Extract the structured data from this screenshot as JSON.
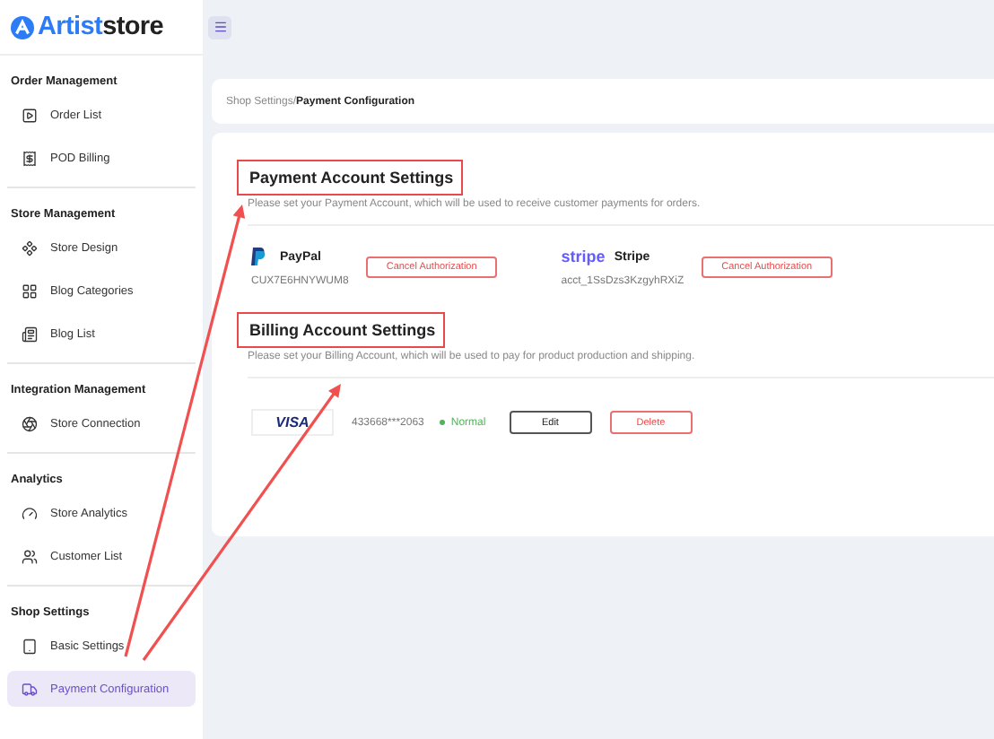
{
  "logo": {
    "brand": "Artist",
    "suffix": "store"
  },
  "sidebar": {
    "groups": [
      {
        "title": "Order Management",
        "items": [
          {
            "label": "Order List",
            "selected": false
          },
          {
            "label": "POD Billing",
            "selected": false
          }
        ]
      },
      {
        "title": "Store Management",
        "items": [
          {
            "label": "Store Design",
            "selected": false
          },
          {
            "label": "Blog Categories",
            "selected": false
          },
          {
            "label": "Blog List",
            "selected": false
          }
        ]
      },
      {
        "title": "Integration Management",
        "items": [
          {
            "label": "Store Connection",
            "selected": false
          }
        ]
      },
      {
        "title": "Analytics",
        "items": [
          {
            "label": "Store Analytics",
            "selected": false
          },
          {
            "label": "Customer List",
            "selected": false
          }
        ]
      },
      {
        "title": "Shop Settings",
        "items": [
          {
            "label": "Basic Settings",
            "selected": false
          },
          {
            "label": "Payment Configuration",
            "selected": true
          }
        ]
      }
    ]
  },
  "breadcrumb": {
    "parent": "Shop Settings/",
    "current": "Payment Configuration"
  },
  "payment": {
    "title": "Payment Account Settings",
    "highlighted": true,
    "description": "Please set your Payment Account, which will be used to receive customer payments for orders.",
    "accounts": [
      {
        "kind": "paypal",
        "name": "PayPal",
        "account": "CUX7E6HNYWUM8",
        "button": "Cancel Authorization"
      },
      {
        "kind": "stripe",
        "logo_text": "stripe",
        "name": "Stripe",
        "account": "acct_1SsDzs3KzgyhRXiZ",
        "button": "Cancel Authorization"
      }
    ]
  },
  "billing": {
    "title": "Billing Account Settings",
    "highlighted": true,
    "description": "Please set your Billing Account, which will be used to pay for product production and shipping.",
    "cards": [
      {
        "brand": "VISA",
        "number": "433668***2063",
        "status": "Normal",
        "color": "#52b35a",
        "edit": "Edit",
        "delete": "Delete"
      }
    ]
  }
}
